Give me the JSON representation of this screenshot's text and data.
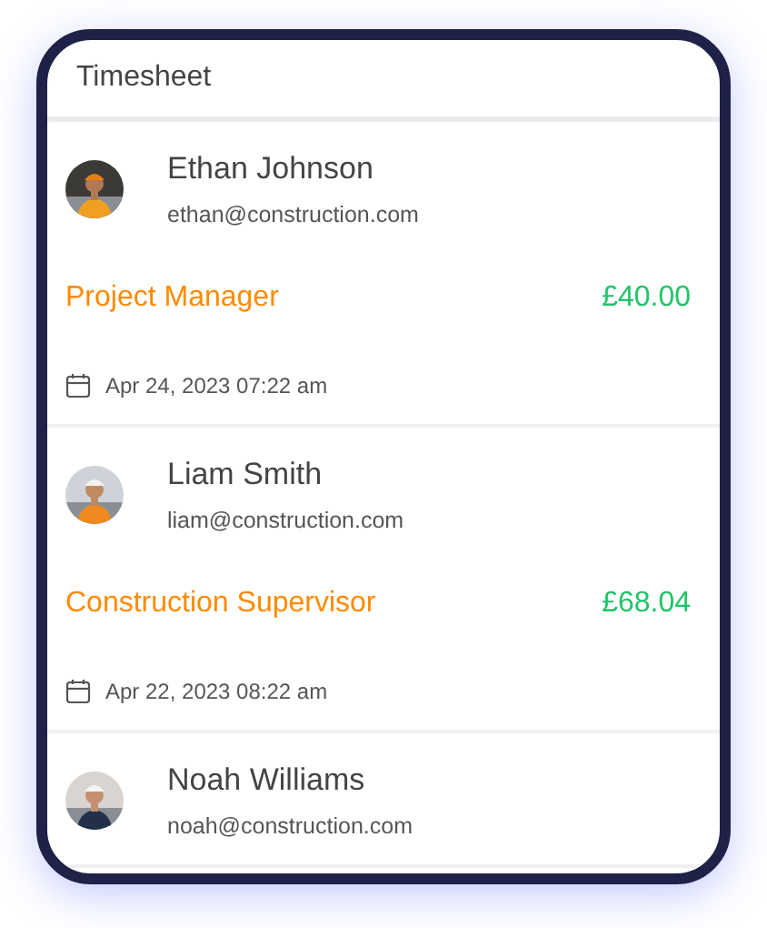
{
  "header": {
    "title": "Timesheet"
  },
  "entries": [
    {
      "name": "Ethan Johnson",
      "email": "ethan@construction.com",
      "role": "Project Manager",
      "amount": "£40.00",
      "date": "Apr 24, 2023 07:22 am"
    },
    {
      "name": "Liam Smith",
      "email": "liam@construction.com",
      "role": "Construction Supervisor",
      "amount": "£68.04",
      "date": "Apr 22, 2023 08:22 am"
    },
    {
      "name": "Noah Williams",
      "email": "noah@construction.com"
    }
  ]
}
